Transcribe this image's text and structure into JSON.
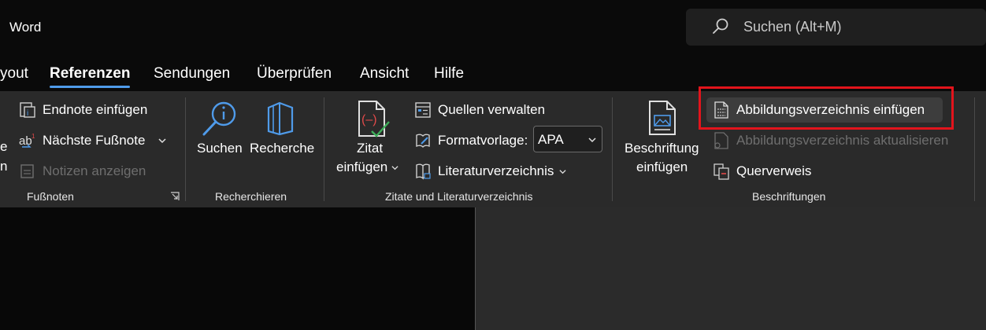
{
  "titlebar": {
    "app_name": "Word",
    "search_placeholder": "Suchen (Alt+M)"
  },
  "tabs": [
    {
      "label": "yout",
      "active": false
    },
    {
      "label": "Referenzen",
      "active": true
    },
    {
      "label": "Sendungen",
      "active": false
    },
    {
      "label": "Überprüfen",
      "active": false
    },
    {
      "label": "Ansicht",
      "active": false
    },
    {
      "label": "Hilfe",
      "active": false
    }
  ],
  "ribbon": {
    "footnotes": {
      "partial_top": "e",
      "partial_bottom": "n",
      "endnote": "Endnote einfügen",
      "next_footnote": "Nächste Fußnote",
      "show_notes": "Notizen anzeigen",
      "group_label": "Fußnoten"
    },
    "research": {
      "search": "Suchen",
      "researcher": "Recherche",
      "group_label": "Recherchieren"
    },
    "citations": {
      "insert_citation_line1": "Zitat",
      "insert_citation_line2": "einfügen",
      "manage_sources": "Quellen verwalten",
      "style_label": "Formatvorlage:",
      "style_value": "APA",
      "bibliography": "Literaturverzeichnis",
      "group_label": "Zitate und Literaturverzeichnis"
    },
    "captions": {
      "insert_caption_line1": "Beschriftung",
      "insert_caption_line2": "einfügen",
      "insert_table_of_figures": "Abbildungsverzeichnis einfügen",
      "update_table": "Abbildungsverzeichnis aktualisieren",
      "cross_reference": "Querverweis",
      "group_label": "Beschriftungen"
    }
  },
  "colors": {
    "accent": "#4f9bea",
    "highlight_box": "#e2141c",
    "ribbon_bg": "#2a2a2a"
  }
}
